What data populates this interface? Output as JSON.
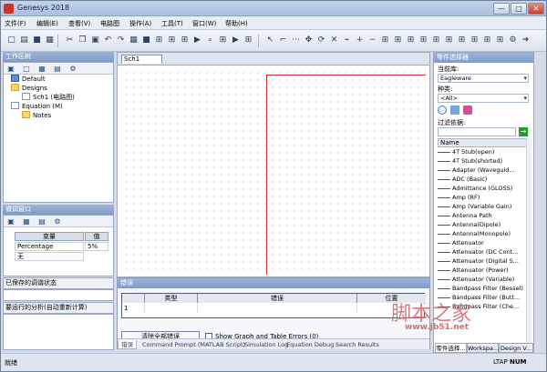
{
  "window": {
    "title": "Genesys 2018",
    "controls": {
      "minimize": "—",
      "maximize": "□",
      "close": "✕"
    }
  },
  "menu": [
    {
      "label": "文件(F)"
    },
    {
      "label": "编辑(E)"
    },
    {
      "label": "查看(V)"
    },
    {
      "label": "电路图"
    },
    {
      "label": "操作(A)"
    },
    {
      "label": "工具(T)"
    },
    {
      "label": "窗口(W)"
    },
    {
      "label": "帮助(H)"
    }
  ],
  "toolbar": {
    "icons": [
      {
        "name": "new-icon",
        "glyph": "□"
      },
      {
        "name": "open-icon",
        "glyph": "▤"
      },
      {
        "name": "save-icon",
        "glyph": "■"
      },
      {
        "name": "print-icon",
        "glyph": "▦"
      },
      {
        "name": "cut-icon",
        "glyph": "✂"
      },
      {
        "name": "copy-icon",
        "glyph": "❐"
      },
      {
        "name": "paste-icon",
        "glyph": "▣"
      },
      {
        "name": "undo-icon",
        "glyph": "↶"
      },
      {
        "name": "redo-icon",
        "glyph": "↷"
      },
      {
        "name": "run-icon",
        "glyph": "▶"
      },
      {
        "name": "zoom-icon",
        "glyph": "⌕"
      },
      {
        "name": "select-icon",
        "glyph": "↖"
      },
      {
        "name": "component-icon",
        "glyph": "⊞"
      },
      {
        "name": "wire-icon",
        "glyph": "⌐"
      },
      {
        "name": "grid-icon",
        "glyph": "⋯"
      },
      {
        "name": "move-icon",
        "glyph": "✥"
      },
      {
        "name": "rotate-icon",
        "glyph": "⟳"
      },
      {
        "name": "delete-icon",
        "glyph": "✕"
      },
      {
        "name": "measure-icon",
        "glyph": "⌁"
      },
      {
        "name": "zoom-in-icon",
        "glyph": "+"
      },
      {
        "name": "zoom-out-icon",
        "glyph": "−"
      },
      {
        "name": "settings-icon",
        "glyph": "⚙"
      },
      {
        "name": "arrow-icon",
        "glyph": "➜"
      }
    ]
  },
  "workspace": {
    "title": "工作区树",
    "items": [
      {
        "label": "Default"
      },
      {
        "label": "Designs"
      },
      {
        "label": "Sch1 (电路图)"
      },
      {
        "label": "Equation (M)"
      },
      {
        "label": "Notes"
      }
    ]
  },
  "tuning": {
    "title": "微调窗口",
    "table_headers": {
      "variable": "变量",
      "value": "值"
    },
    "rows": [
      {
        "variable": "Percentage",
        "value": "5%"
      },
      {
        "variable": "无",
        "value": ""
      }
    ]
  },
  "saved_state": {
    "title": "已保存的调谐状态"
  },
  "analysis": {
    "title": "要运行的分析(自动重新计算)"
  },
  "canvas": {
    "tab": "Sch1"
  },
  "errors": {
    "title": "错误",
    "columns": [
      {
        "label": ""
      },
      {
        "label": "类型"
      },
      {
        "label": "错误"
      },
      {
        "label": "位置"
      }
    ],
    "row_index": "1",
    "clear_button": "清除全部错误",
    "checkbox_label": "Show Graph and Table Errors (0)",
    "tabs": [
      {
        "label": "错误"
      },
      {
        "label": "Command Prompt (MATLAB Script)"
      },
      {
        "label": "Simulation Log"
      },
      {
        "label": "Equation Debug"
      },
      {
        "label": "Search Results"
      }
    ]
  },
  "parts": {
    "title": "零件选择器",
    "library_label": "当前库:",
    "library_value": "Eagleware",
    "category_label": "种类:",
    "category_value": "<All>",
    "filter_label": "过滤依据:",
    "list_header": "Name",
    "items": [
      {
        "label": "4T Stub(open)"
      },
      {
        "label": "4T Stub(shorted)"
      },
      {
        "label": "Adapter (Waveguid..."
      },
      {
        "label": "ADC (Basic)"
      },
      {
        "label": "Admittance (GLOSS)"
      },
      {
        "label": "Amp (RF)"
      },
      {
        "label": "Amp (Variable Gain)"
      },
      {
        "label": "Antenna Path"
      },
      {
        "label": "Antenna(Dipole)"
      },
      {
        "label": "Antenna(Monopole)"
      },
      {
        "label": "Attenuator"
      },
      {
        "label": "Attenuator (DC Cont..."
      },
      {
        "label": "Attenuator (Digital S..."
      },
      {
        "label": "Attenuator (Power)"
      },
      {
        "label": "Attenuator (Variable)"
      },
      {
        "label": "Bandpass Filter (Bessel)"
      },
      {
        "label": "Bandpass Filter (Butt..."
      },
      {
        "label": "Bandpass Filter (Che..."
      }
    ],
    "tabs": [
      {
        "label": "零件选择..."
      },
      {
        "label": "Workspa..."
      },
      {
        "label": "Design V..."
      }
    ]
  },
  "status": {
    "left": "就绪",
    "right": "LTAP",
    "mode": "NUM"
  },
  "watermark": {
    "site": "www.jb51.net"
  }
}
